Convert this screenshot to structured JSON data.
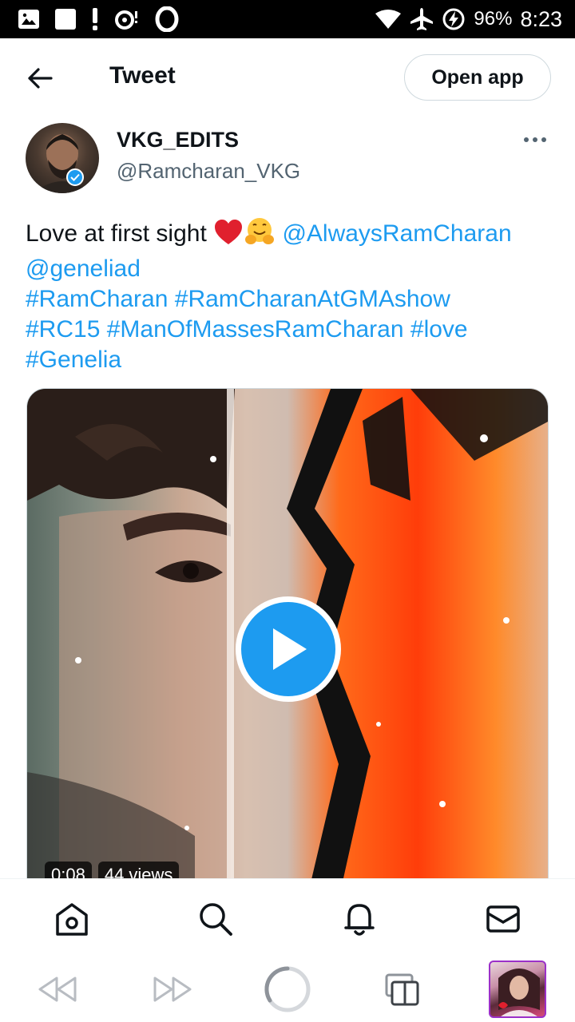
{
  "status_bar": {
    "battery_percent": "96%",
    "time": "8:23",
    "icons": [
      "gallery-icon",
      "square-icon",
      "alert-icon",
      "sync-icon",
      "opera-icon",
      "wifi-icon",
      "airplane-icon",
      "battery-charging-icon"
    ]
  },
  "header": {
    "title": "Tweet",
    "open_app_label": "Open app"
  },
  "tweet": {
    "author_name": "VKG_EDITS",
    "author_handle": "@Ramcharan_VKG",
    "verified": true,
    "text_plain": "Love at first sight ",
    "emojis": [
      "red-heart",
      "hugging-face"
    ],
    "mentions": [
      "@AlwaysRamCharan",
      "@geneliad"
    ],
    "hashtags": [
      "#RamCharan",
      "#RamCharanAtGMAshow",
      "#RC15",
      "#ManOfMassesRamCharan",
      "#love",
      "#Genelia"
    ],
    "media": {
      "type": "video",
      "duration": "0:08",
      "views": "44 views"
    }
  },
  "bottom_nav": {
    "items": [
      "home",
      "search",
      "notifications",
      "messages"
    ]
  },
  "browser_toolbar": {
    "items": [
      "back",
      "forward",
      "reload",
      "tabs",
      "profile"
    ]
  },
  "colors": {
    "link": "#1d9bf0",
    "text": "#0f1419",
    "secondary": "#536471",
    "status_bar": "#000000"
  }
}
